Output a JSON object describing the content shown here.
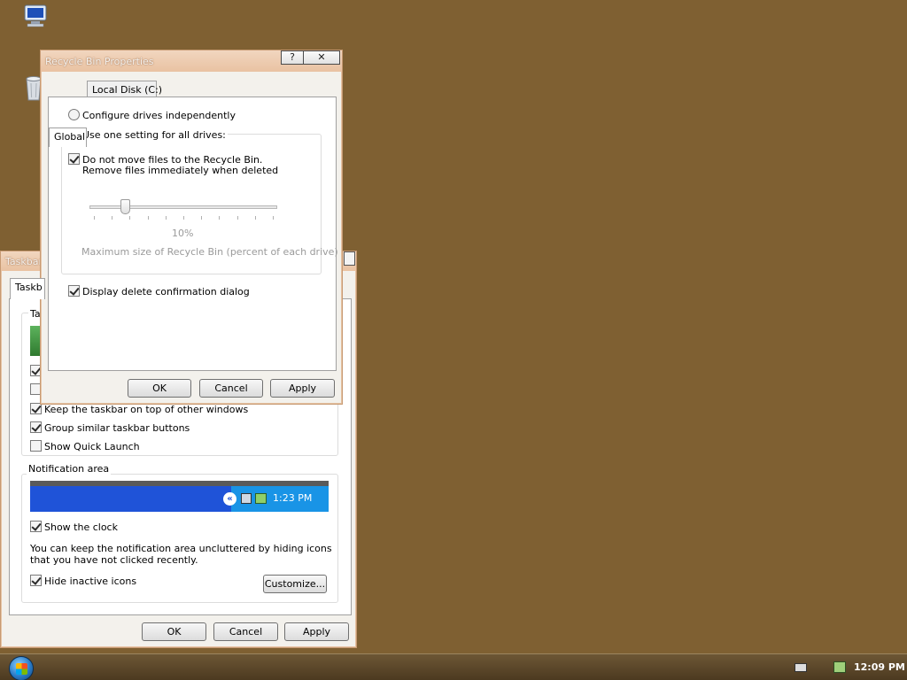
{
  "desktop": {
    "icons": [
      {
        "name": "computer-icon"
      },
      {
        "name": "recycle-bin-icon"
      }
    ]
  },
  "taskbar_props": {
    "title": "Taskbar and Start Menu Properties",
    "title_visible": "Taskbar",
    "tab_visible": "Taskb",
    "group_title_visible": "Ta",
    "options": [
      {
        "label": "Keep the taskbar on top of other windows",
        "checked": true
      },
      {
        "label": "Group similar taskbar buttons",
        "checked": true
      },
      {
        "label": "Show Quick Launch",
        "checked": false
      }
    ],
    "notification": {
      "title": "Notification area",
      "preview_time": "1:23 PM",
      "show_clock": "Show the clock",
      "info": "You can keep the notification area uncluttered by hiding icons that you have not clicked recently.",
      "hide_inactive": "Hide inactive icons",
      "customize": "Customize..."
    },
    "buttons": {
      "ok": "OK",
      "cancel": "Cancel",
      "apply": "Apply"
    }
  },
  "recycle": {
    "title": "Recycle Bin Properties",
    "help": "?",
    "close": "✕",
    "tabs": [
      "Global",
      "Local Disk (C:)"
    ],
    "configure_independently": "Configure drives independently",
    "use_one_setting": "Use one setting for all drives:",
    "do_not_move_1": "Do not move files to the Recycle Bin.",
    "do_not_move_2": "Remove files immediately when deleted",
    "slider_value": 10,
    "percent_label": "10%",
    "max_size_label": "Maximum size of Recycle Bin (percent of each drive)",
    "display_confirm": "Display delete confirmation dialog",
    "buttons": {
      "ok": "OK",
      "cancel": "Cancel",
      "apply": "Apply"
    }
  },
  "taskbar": {
    "clock": "12:09 PM"
  }
}
